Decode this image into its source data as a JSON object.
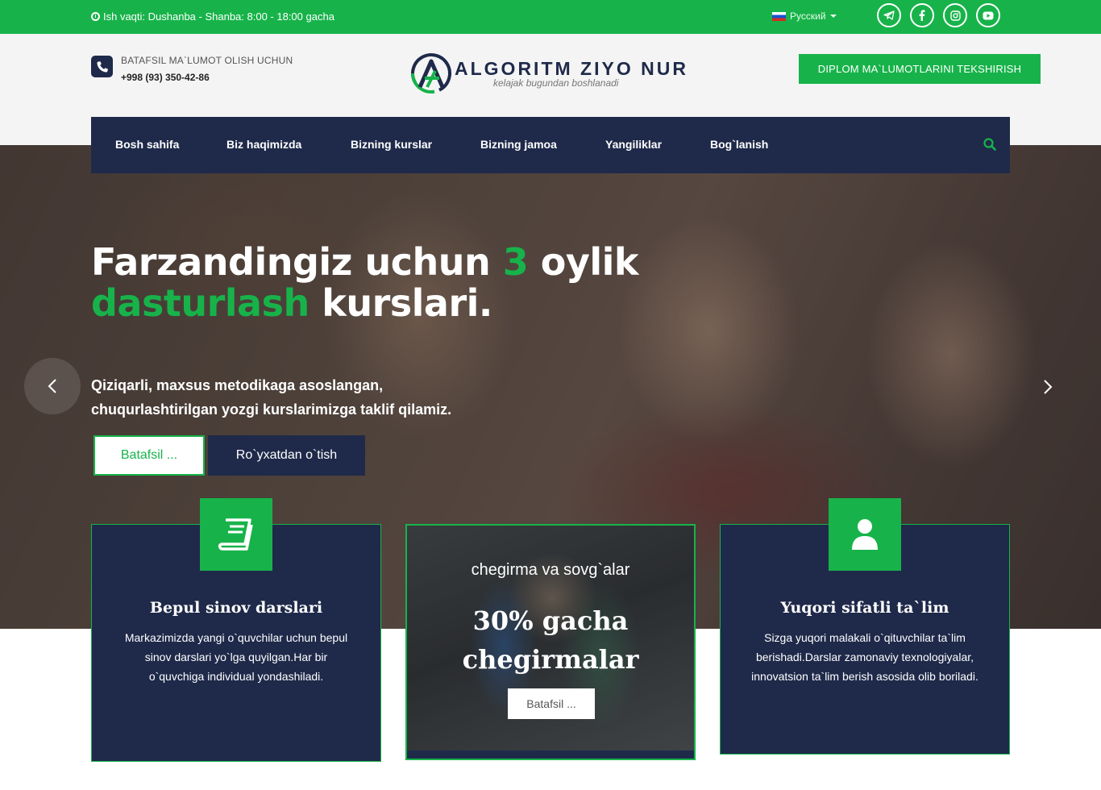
{
  "topbar": {
    "hours": "Ish vaqti: Dushanba - Shanba: 8:00 - 18:00 gacha",
    "language": "Русский",
    "socials": [
      "telegram-icon",
      "facebook-icon",
      "instagram-icon",
      "youtube-icon"
    ]
  },
  "header": {
    "info_label": "BATAFSIL MA`LUMOT OLISH UCHUN",
    "phone": "+998 (93) 350-42-86",
    "logo_name": "ALGORITM ZIYO NUR",
    "logo_tagline": "kelajak bugundan boshlanadi",
    "diplom_button": "DIPLOM MA`LUMOTLARINI TEKSHIRISH"
  },
  "nav": {
    "items": [
      "Bosh sahifa",
      "Biz haqimizda",
      "Bizning kurslar",
      "Bizning jamoa",
      "Yangiliklar",
      "Bog`lanish"
    ]
  },
  "hero": {
    "title_part1": "Farzandingiz uchun ",
    "title_number": "3",
    "title_part2": " oylik",
    "title_green": "dasturlash",
    "title_part3": " kurslari.",
    "subtitle_line1": "Qiziqarli, maxsus metodikaga asoslangan,",
    "subtitle_line2": "chuqurlashtirilgan yozgi kurslarimizga taklif qilamiz.",
    "more_button": "Batafsil ...",
    "register_button": "Ro`yxatdan o`tish"
  },
  "cards": {
    "left": {
      "title": "Bepul sinov darslari",
      "text": "Markazimizda yangi o`quvchilar uchun bepul sinov darslari yo`lga quyilgan.Har bir o`quvchiga individual yondashiladi."
    },
    "middle": {
      "subtitle": "chegirma va sovg`alar",
      "big_line1": "30% gacha",
      "big_line2": "chegirmalar",
      "button": "Batafsil ..."
    },
    "right": {
      "title": "Yuqori sifatli ta`lim",
      "text": "Sizga yuqori malakali o`qituvchilar ta`lim berishadi.Darslar zamonaviy texnologiyalar, innovatsion ta`lim berish asosida olib boriladi."
    }
  },
  "colors": {
    "accent_green": "#17b34a",
    "navy": "#1f2a4a"
  }
}
